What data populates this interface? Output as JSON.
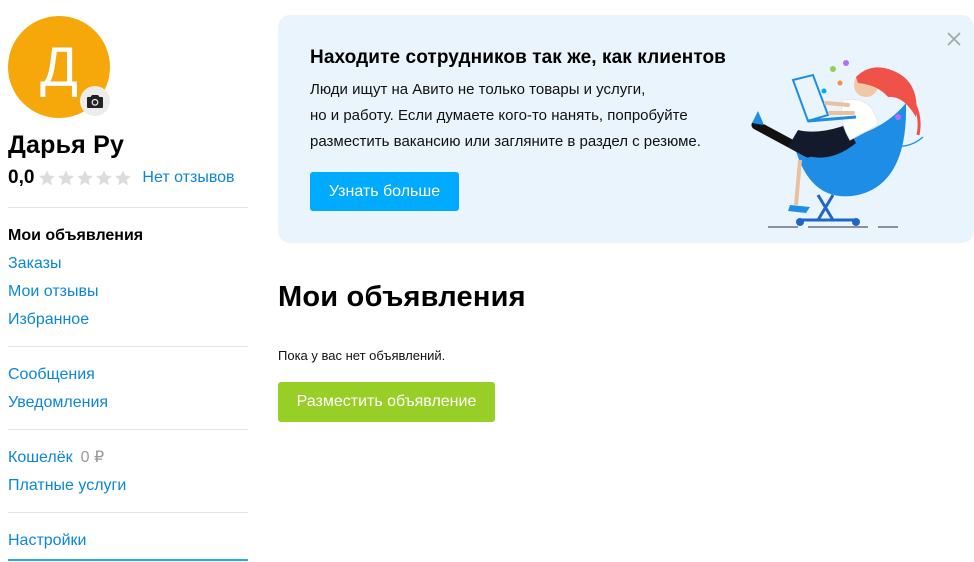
{
  "profile": {
    "avatar_letter": "Д",
    "name": "Дарья Ру",
    "rating": "0,0",
    "stars_filled": 0,
    "stars_total": 5,
    "reviews_link": "Нет отзывов"
  },
  "sidebar": {
    "group1": [
      {
        "label": "Мои объявления",
        "active": true
      },
      {
        "label": "Заказы"
      },
      {
        "label": "Мои отзывы"
      },
      {
        "label": "Избранное"
      }
    ],
    "group2": [
      {
        "label": "Сообщения"
      },
      {
        "label": "Уведомления"
      }
    ],
    "group3": {
      "wallet_label": "Кошелёк",
      "wallet_balance": "0 ₽",
      "paid_services": "Платные услуги"
    },
    "group4": [
      {
        "label": "Настройки"
      }
    ]
  },
  "banner": {
    "title": "Находите сотрудников так же, как клиентов",
    "text_line1": "Люди ищут на Авито не только товары и услуги,",
    "text_line2": "но и работу. Если думаете кого-то нанять, попробуйте",
    "text_line3": "разместить вакансию или загляните в раздел с резюме.",
    "button": "Узнать больше"
  },
  "main": {
    "title": "Мои объявления",
    "empty_text": "Пока у вас нет объявлений.",
    "post_button": "Разместить объявление"
  },
  "colors": {
    "link": "#0a87d6",
    "avatar": "#f6a80b",
    "banner_bg": "#e9f4fc",
    "banner_button": "#00aaff",
    "post_button": "#97cf26"
  }
}
